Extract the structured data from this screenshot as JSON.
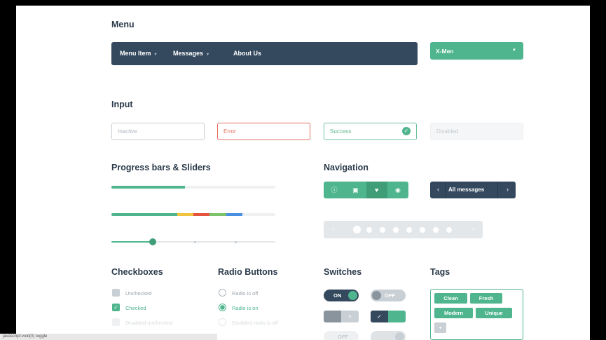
{
  "sections": {
    "menu": "Menu",
    "input": "Input",
    "progress": "Progress bars & Sliders",
    "navigation": "Navigation",
    "checkboxes": "Checkboxes",
    "radio": "Radio Buttons",
    "switches": "Switches",
    "tags": "Tags"
  },
  "menu": {
    "items": [
      "Menu Item",
      "Messages",
      "About Us"
    ],
    "dropdown": "X-Men"
  },
  "inputs": {
    "inactive": "Inactive",
    "error": "Error",
    "success": "Success",
    "disabled": "Disabled"
  },
  "progress": {
    "bar1": 0.45,
    "bar2_segments": [
      {
        "color": "#4fb58e",
        "fraction": 0.4
      },
      {
        "color": "#f0c341",
        "fraction": 0.1
      },
      {
        "color": "#e5553d",
        "fraction": 0.1
      },
      {
        "color": "#7cc36b",
        "fraction": 0.1
      },
      {
        "color": "#4a90e2",
        "fraction": 0.1
      }
    ],
    "slider": 0.25
  },
  "navigation": {
    "icons": [
      "info-icon",
      "lock-icon",
      "heart-icon",
      "eye-icon"
    ],
    "active_index": 2,
    "messages_label": "All messages",
    "pager_dots": 8,
    "pager_active": 1
  },
  "checkboxes": [
    {
      "label": "Unchecked",
      "state": "unchecked"
    },
    {
      "label": "Checked",
      "state": "checked"
    },
    {
      "label": "Disabled unchecked",
      "state": "disabled"
    }
  ],
  "radios": [
    {
      "label": "Radio is off",
      "state": "off"
    },
    {
      "label": "Radio is on",
      "state": "on"
    },
    {
      "label": "Disabled radio is off",
      "state": "disabled"
    }
  ],
  "switches": {
    "on_label": "ON",
    "off_label": "OFF"
  },
  "tags": [
    "Clean",
    "Fresh",
    "Modern",
    "Unique"
  ],
  "status_text": "javascript:void(0) toggle",
  "colors": {
    "accent": "#4fb58e",
    "dark": "#34495e",
    "error": "#e36e5e",
    "muted": "#c8cfd5"
  }
}
